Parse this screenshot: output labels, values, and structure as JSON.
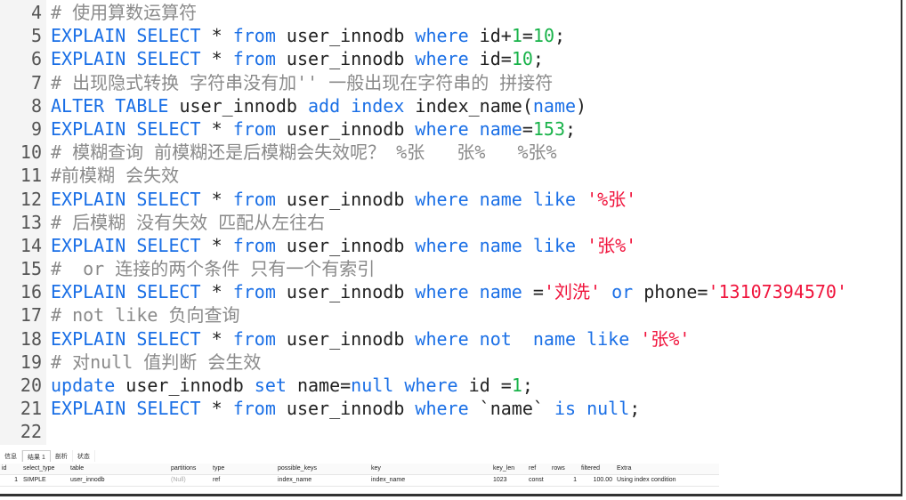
{
  "editor": {
    "lines": [
      {
        "n": "4",
        "tokens": [
          [
            "c",
            "# 使用算数运算符"
          ]
        ]
      },
      {
        "n": "5",
        "tokens": [
          [
            "k",
            "EXPLAIN SELECT"
          ],
          [
            "t",
            " * "
          ],
          [
            "k",
            "from"
          ],
          [
            "t",
            " user_innodb "
          ],
          [
            "k",
            "where"
          ],
          [
            "t",
            " id+"
          ],
          [
            "n",
            "1"
          ],
          [
            "t",
            "="
          ],
          [
            "n",
            "10"
          ],
          [
            "t",
            ";"
          ]
        ]
      },
      {
        "n": "6",
        "tokens": [
          [
            "k",
            "EXPLAIN SELECT"
          ],
          [
            "t",
            " * "
          ],
          [
            "k",
            "from"
          ],
          [
            "t",
            " user_innodb "
          ],
          [
            "k",
            "where"
          ],
          [
            "t",
            " id="
          ],
          [
            "n",
            "10"
          ],
          [
            "t",
            ";"
          ]
        ]
      },
      {
        "n": "7",
        "tokens": [
          [
            "c",
            "# 出现隐式转换 字符串没有加'' 一般出现在字符串的 拼接符"
          ]
        ]
      },
      {
        "n": "8",
        "tokens": [
          [
            "k",
            "ALTER TABLE"
          ],
          [
            "t",
            " user_innodb "
          ],
          [
            "k",
            "add index"
          ],
          [
            "t",
            " index_name("
          ],
          [
            "k",
            "name"
          ],
          [
            "t",
            ")"
          ]
        ]
      },
      {
        "n": "9",
        "tokens": [
          [
            "k",
            "EXPLAIN SELECT"
          ],
          [
            "t",
            " * "
          ],
          [
            "k",
            "from"
          ],
          [
            "t",
            " user_innodb "
          ],
          [
            "k",
            "where name"
          ],
          [
            "t",
            "="
          ],
          [
            "n",
            "153"
          ],
          [
            "t",
            ";"
          ]
        ]
      },
      {
        "n": "10",
        "tokens": [
          [
            "c",
            "# 模糊查询 前模糊还是后模糊会失效呢？ %张   张%   %张%"
          ]
        ]
      },
      {
        "n": "11",
        "tokens": [
          [
            "c",
            "#前模糊 会失效"
          ]
        ]
      },
      {
        "n": "12",
        "tokens": [
          [
            "k",
            "EXPLAIN SELECT"
          ],
          [
            "t",
            " * "
          ],
          [
            "k",
            "from"
          ],
          [
            "t",
            " user_innodb "
          ],
          [
            "k",
            "where name like"
          ],
          [
            "t",
            " "
          ],
          [
            "s",
            "'%张'"
          ]
        ]
      },
      {
        "n": "13",
        "tokens": [
          [
            "c",
            "# 后模糊 没有失效 匹配从左往右"
          ]
        ]
      },
      {
        "n": "14",
        "tokens": [
          [
            "k",
            "EXPLAIN SELECT"
          ],
          [
            "t",
            " * "
          ],
          [
            "k",
            "from"
          ],
          [
            "t",
            " user_innodb "
          ],
          [
            "k",
            "where name like"
          ],
          [
            "t",
            " "
          ],
          [
            "s",
            "'张%'"
          ]
        ]
      },
      {
        "n": "15",
        "tokens": [
          [
            "c",
            "#  or 连接的两个条件 只有一个有索引"
          ]
        ]
      },
      {
        "n": "16",
        "tokens": [
          [
            "k",
            "EXPLAIN SELECT"
          ],
          [
            "t",
            " * "
          ],
          [
            "k",
            "from"
          ],
          [
            "t",
            " user_innodb "
          ],
          [
            "k",
            "where name"
          ],
          [
            "t",
            " ="
          ],
          [
            "s",
            "'刘洗'"
          ],
          [
            "t",
            " "
          ],
          [
            "k",
            "or"
          ],
          [
            "t",
            " phone="
          ],
          [
            "s",
            "'13107394570'"
          ]
        ]
      },
      {
        "n": "17",
        "tokens": [
          [
            "c",
            "# not like 负向查询"
          ]
        ]
      },
      {
        "n": "18",
        "tokens": [
          [
            "k",
            "EXPLAIN SELECT"
          ],
          [
            "t",
            " * "
          ],
          [
            "k",
            "from"
          ],
          [
            "t",
            " user_innodb "
          ],
          [
            "k",
            "where not  name like"
          ],
          [
            "t",
            " "
          ],
          [
            "s",
            "'张%'"
          ]
        ]
      },
      {
        "n": "19",
        "tokens": [
          [
            "c",
            "# 对null 值判断 会生效"
          ]
        ]
      },
      {
        "n": "20",
        "tokens": [
          [
            "k",
            "update"
          ],
          [
            "t",
            " user_innodb "
          ],
          [
            "k",
            "set"
          ],
          [
            "t",
            " name="
          ],
          [
            "k",
            "null"
          ],
          [
            "t",
            " "
          ],
          [
            "k",
            "where"
          ],
          [
            "t",
            " id ="
          ],
          [
            "n",
            "1"
          ],
          [
            "t",
            ";"
          ]
        ]
      },
      {
        "n": "21",
        "tokens": [
          [
            "k",
            "EXPLAIN SELECT"
          ],
          [
            "t",
            " * "
          ],
          [
            "k",
            "from"
          ],
          [
            "t",
            " user_innodb "
          ],
          [
            "k",
            "where"
          ],
          [
            "t",
            " `name` "
          ],
          [
            "k",
            "is null"
          ],
          [
            "t",
            ";"
          ]
        ]
      },
      {
        "n": "22",
        "tokens": []
      }
    ]
  },
  "result_tabs": [
    {
      "label": "信息"
    },
    {
      "label": "结果 1",
      "active": true
    },
    {
      "label": "剖析"
    },
    {
      "label": "状态"
    }
  ],
  "result": {
    "columns": [
      "id",
      "select_type",
      "table",
      "partitions",
      "type",
      "possible_keys",
      "key",
      "key_len",
      "ref",
      "rows",
      "filtered",
      "Extra"
    ],
    "rows": [
      [
        "1",
        "SIMPLE",
        "user_innodb",
        "(Null)",
        "ref",
        "index_name",
        "index_name",
        "1023",
        "const",
        "1",
        "100.00",
        "Using index condition"
      ]
    ]
  },
  "colors": {
    "keyword": "#1a6fe6",
    "number": "#19b34a",
    "string": "#f0143c",
    "comment": "#8a8a8a"
  }
}
